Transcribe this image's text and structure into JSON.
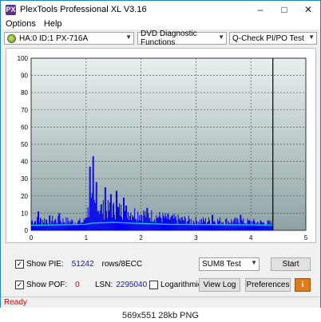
{
  "window": {
    "title": "PlexTools Professional XL V3.16",
    "app_icon": "PX"
  },
  "menu": {
    "items": [
      "Options",
      "Help"
    ]
  },
  "toolbar": {
    "drive": "HA:0 ID:1  PX-716A",
    "function": "DVD Diagnostic Functions",
    "test": "Q-Check PI/PO Test"
  },
  "chart_data": {
    "type": "bar",
    "title": "",
    "xlabel": "",
    "ylabel": "",
    "xlim": [
      0,
      5
    ],
    "ylim": [
      0,
      100
    ],
    "x_ticks": [
      "0",
      "1",
      "2",
      "3",
      "4",
      "5"
    ],
    "y_ticks": [
      "100",
      "90",
      "80",
      "70",
      "60",
      "50",
      "40",
      "30",
      "20",
      "10",
      "0"
    ],
    "grid": true,
    "end_marker_x": 4.4,
    "series": [
      {
        "kind": "bars",
        "color": "#0000ee",
        "profile": [
          [
            0,
            8
          ],
          [
            0.3,
            9
          ],
          [
            0.6,
            8
          ],
          [
            0.95,
            7
          ],
          [
            1.0,
            14
          ],
          [
            1.1,
            22
          ],
          [
            1.3,
            18
          ],
          [
            1.6,
            17
          ],
          [
            2.0,
            14
          ],
          [
            2.5,
            10
          ],
          [
            3.0,
            8
          ],
          [
            3.5,
            8
          ],
          [
            4.0,
            7
          ],
          [
            4.4,
            6
          ]
        ],
        "spikes": [
          [
            1.07,
            37
          ],
          [
            1.12,
            43
          ],
          [
            1.18,
            28
          ],
          [
            1.34,
            25
          ],
          [
            1.45,
            21
          ],
          [
            1.55,
            23
          ],
          [
            1.68,
            19
          ],
          [
            0.12,
            11
          ],
          [
            0.5,
            10
          ],
          [
            2.1,
            13
          ],
          [
            3.3,
            9
          ],
          [
            3.8,
            9
          ]
        ]
      },
      {
        "kind": "line",
        "color": "#00c8f0",
        "points": [
          [
            0,
            3.0
          ],
          [
            0.5,
            3.2
          ],
          [
            1.0,
            3.5
          ],
          [
            1.1,
            4.2
          ],
          [
            1.5,
            4.6
          ],
          [
            2.0,
            4.0
          ],
          [
            2.5,
            3.5
          ],
          [
            3.0,
            3.4
          ],
          [
            3.5,
            3.3
          ],
          [
            4.0,
            3.2
          ],
          [
            4.4,
            3.1
          ]
        ]
      }
    ]
  },
  "controls": {
    "show_pie_label": "Show PIE:",
    "pie_value": "51242",
    "pie_unit": "rows/8ECC",
    "show_pof_label": "Show POF:",
    "pof_value": "0",
    "lsn_label": "LSN:",
    "lsn_value": "2295040",
    "logarithmic_label": "Logarithmic",
    "test_select": "SUM8 Test",
    "start_label": "Start",
    "viewlog_label": "View Log",
    "preferences_label": "Preferences"
  },
  "status": {
    "text": "Ready"
  },
  "caption": {
    "text": "569x551  28kb  PNG"
  },
  "colors": {
    "accent": "#1883d7",
    "status": "#d40000",
    "value": "#1a1aa6"
  }
}
